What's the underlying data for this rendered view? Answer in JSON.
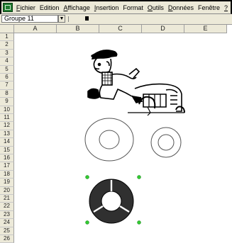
{
  "menubar": {
    "items": [
      {
        "mnemonic": "F",
        "rest": "ichier"
      },
      {
        "mnemonic": "",
        "rest": "Edition"
      },
      {
        "mnemonic": "A",
        "rest": "ffichage"
      },
      {
        "mnemonic": "I",
        "rest": "nsertion"
      },
      {
        "mnemonic": "",
        "rest": "Format"
      },
      {
        "mnemonic": "O",
        "rest": "utils"
      },
      {
        "mnemonic": "D",
        "rest": "onnées"
      },
      {
        "mnemonic": "",
        "rest": "Fenêtre"
      },
      {
        "mnemonic": "?",
        "rest": ""
      }
    ]
  },
  "formula_bar": {
    "name_box": "Groupe 11",
    "name_box_icon": "dropdown-arrow-icon",
    "function_icon": "function-icon"
  },
  "columns": [
    "A",
    "B",
    "C",
    "D",
    "E"
  ],
  "rows": [
    "1",
    "2",
    "3",
    "4",
    "5",
    "6",
    "7",
    "8",
    "9",
    "10",
    "11",
    "12",
    "13",
    "14",
    "15",
    "16",
    "17",
    "18",
    "19",
    "20",
    "21",
    "22",
    "23",
    "24",
    "25",
    "26"
  ],
  "drawing": {
    "colors": {
      "outline": "#000000",
      "fill_dark": "#303030",
      "selection_handle": "#33cc33"
    },
    "shapes": [
      "farmer-on-tractor-clipart",
      "large-washer-ring",
      "small-washer-ring",
      "selected-dark-segmented-ring"
    ]
  }
}
